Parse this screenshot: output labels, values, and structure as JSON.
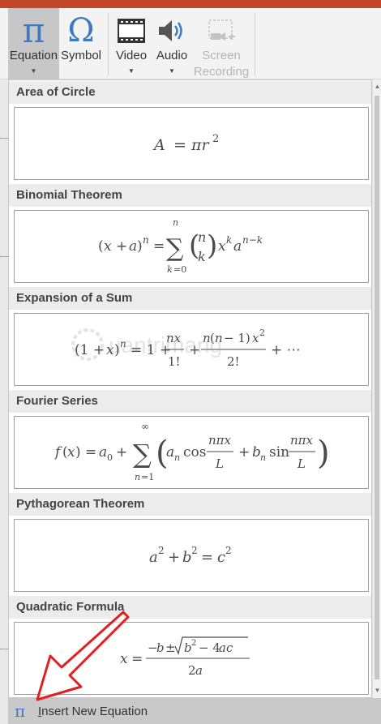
{
  "ribbon": {
    "equation": {
      "label": "Equation",
      "icon": "pi-icon"
    },
    "symbol": {
      "label": "Symbol",
      "icon": "omega-icon"
    },
    "video": {
      "label": "Video",
      "icon": "film-icon"
    },
    "audio": {
      "label": "Audio",
      "icon": "speaker-icon"
    },
    "screen_recording": {
      "label_line1": "Screen",
      "label_line2": "Recording",
      "icon": "screen-recording-icon"
    }
  },
  "gallery": {
    "sections": [
      {
        "title": "Area of Circle"
      },
      {
        "title": "Binomial Theorem"
      },
      {
        "title": "Expansion of a Sum"
      },
      {
        "title": "Fourier Series"
      },
      {
        "title": "Pythagorean Theorem"
      },
      {
        "title": "Quadratic Formula"
      }
    ]
  },
  "insert": {
    "label_first": "I",
    "label_rest": "nsert New Equation"
  },
  "watermark": {
    "text": "uantrimang"
  },
  "colors": {
    "accent": "#3d7ac4",
    "titlebar": "#c24729",
    "arrow": "#e02020"
  }
}
